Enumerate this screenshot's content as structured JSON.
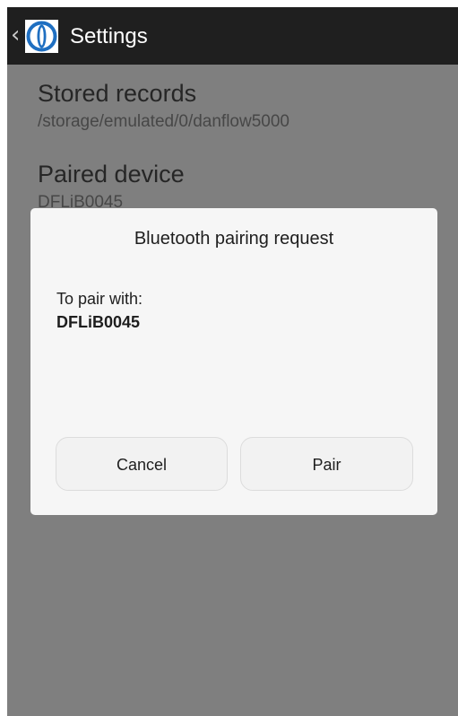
{
  "app_bar": {
    "back_glyph": "‹",
    "title": "Settings",
    "logo_icon": "app-logo-icon",
    "background": "#1f1f1f"
  },
  "preferences": {
    "stored_records": {
      "title": "Stored records",
      "summary": "/storage/emulated/0/danflow5000"
    },
    "paired_device": {
      "title": "Paired device",
      "summary": "DFLiB0045"
    }
  },
  "dialog": {
    "title": "Bluetooth pairing request",
    "pair_label": "To pair with:",
    "device_name": "DFLiB0045",
    "cancel_label": "Cancel",
    "pair_label_button": "Pair"
  },
  "colors": {
    "scrim": "#7f7f7f",
    "dialog_bg": "#f6f6f6",
    "logo_blue": "#1f6fc1"
  }
}
